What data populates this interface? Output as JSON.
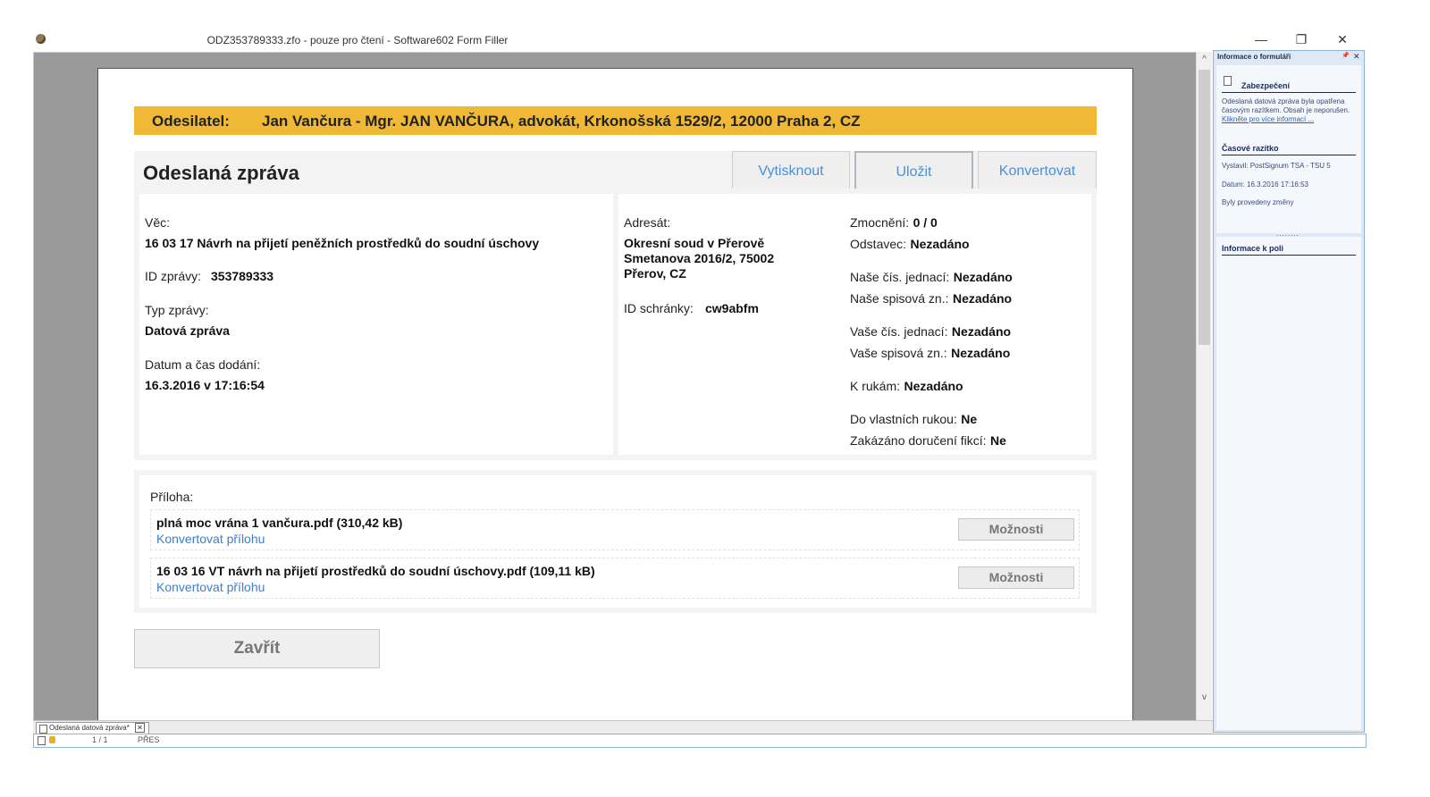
{
  "window": {
    "title": "ODZ353789333.zfo - pouze pro čtení - Software602 Form Filler",
    "min_glyph": "—",
    "max_glyph": "❐",
    "close_glyph": "✕",
    "icon": "app-icon"
  },
  "scroll": {
    "up": "^",
    "down": "v"
  },
  "form": {
    "sender_label": "Odesilatel:",
    "sender_value": "Jan Vančura - Mgr. JAN VANČURA, advokát, Krkonošská 1529/2, 12000 Praha 2, CZ",
    "heading": "Odeslaná zpráva",
    "buttons": {
      "print": "Vytisknout",
      "save": "Uložit",
      "convert": "Konvertovat"
    },
    "left": {
      "subject_label": "Věc:",
      "subject_value": "16 03 17 Návrh na přijetí peněžních prostředků do soudní úschovy",
      "id_label": "ID zprávy:",
      "id_value": "353789333",
      "type_label": "Typ zprávy:",
      "type_value": "Datová zpráva",
      "date_label": "Datum a čas dodání:",
      "date_value": "16.3.2016 v 17:16:54"
    },
    "recipient": {
      "label": "Adresát:",
      "line1": "Okresní soud v Přerově",
      "line2": "Smetanova 2016/2, 75002",
      "line3": "Přerov, CZ",
      "box_label": "ID schránky:",
      "box_value": "cw9abfm"
    },
    "details": [
      {
        "label": "Zmocnění:",
        "value": "0 / 0"
      },
      {
        "label": "Odstavec:",
        "value": "Nezadáno"
      },
      {
        "label": "Naše čís. jednací:",
        "value": "Nezadáno"
      },
      {
        "label": "Naše spisová zn.:",
        "value": "Nezadáno"
      },
      {
        "label": "Vaše čís. jednací:",
        "value": "Nezadáno"
      },
      {
        "label": "Vaše spisová zn.:",
        "value": "Nezadáno"
      },
      {
        "label": "K rukám:",
        "value": "Nezadáno"
      },
      {
        "label": "Do vlastních rukou:",
        "value": "Ne"
      },
      {
        "label": "Zakázáno doručení fikcí:",
        "value": "Ne"
      }
    ],
    "attachments_label": "Příloha:",
    "attachments": [
      {
        "name": "plná moc vrána 1 vančura.pdf (310,42 kB)",
        "link": "Konvertovat přílohu",
        "options": "Možnosti"
      },
      {
        "name": "16 03 16 VT návrh na přijetí prostředků do soudní úschovy.pdf (109,11 kB)",
        "link": "Konvertovat přílohu",
        "options": "Možnosti"
      }
    ],
    "close": "Zavřít"
  },
  "tabs": {
    "doc_tab": "Odeslaná datová zpráva*",
    "doc_tab_close": "✕"
  },
  "status": {
    "page": "1 / 1",
    "mode": "PŘES"
  },
  "side_panel": {
    "title": "Informace o formuláři",
    "pin": "📌",
    "close": "✕",
    "security_heading": "Zabezpečení",
    "security_text": "Odeslaná datová zpráva byla opatřena časovým razítkem. Obsah je neporušen.",
    "security_link": "Klikněte pro více informací ...",
    "timestamp_heading": "Časové razítko",
    "issuer": "Vystavil: PostSignum TSA - TSU 5",
    "date": "Datum: 16.3.2016 17:16:53",
    "changes": "Byly provedeny změny",
    "grip": "........",
    "field_info_heading": "Informace k poli"
  }
}
